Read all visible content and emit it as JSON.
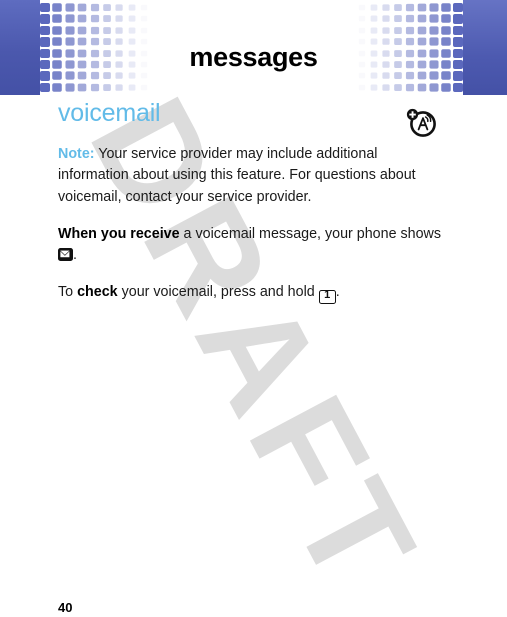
{
  "header": {
    "title": "messages",
    "band_color": "#4b58ad",
    "square_color": "#5b68bd"
  },
  "icons": {
    "network": "network-antenna-plus-icon",
    "envelope": "envelope-icon",
    "key_one": "keypad-one-icon",
    "key_one_label": "1"
  },
  "section": {
    "title": "voicemail",
    "title_color": "#62bbe8"
  },
  "paragraphs": [
    {
      "lead": "Note:",
      "lead_style": "note",
      "body": " Your service provider may include additional information about using this feature. For questions about voicemail, contact your service provider."
    },
    {
      "lead": "When you receive",
      "lead_style": "bold",
      "body_before": " a voicemail message, your phone shows ",
      "body_after": "."
    },
    {
      "prefix": "To ",
      "lead": "check",
      "lead_style": "bold",
      "body_before": " your voicemail, press and hold ",
      "body_after": "."
    }
  ],
  "watermark": {
    "text": "DRAFT",
    "color": "#dcdcdc"
  },
  "footer": {
    "page_number": "40"
  }
}
